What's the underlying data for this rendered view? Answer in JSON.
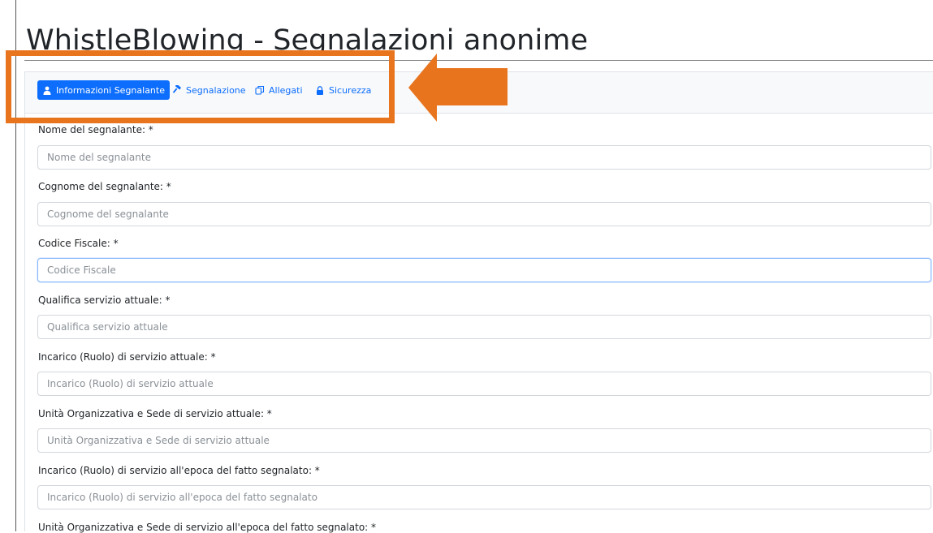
{
  "header": {
    "title": "WhistleBlowing - Segnalazioni anonime"
  },
  "tabs": [
    {
      "label": "Informazioni Segnalante",
      "icon": "user-icon",
      "active": true
    },
    {
      "label": "Segnalazione",
      "icon": "gavel-icon",
      "active": false
    },
    {
      "label": "Allegati",
      "icon": "copy-icon",
      "active": false
    },
    {
      "label": "Sicurezza",
      "icon": "lock-icon",
      "active": false
    }
  ],
  "form": {
    "fields": [
      {
        "label": "Nome del segnalante: *",
        "placeholder": "Nome del segnalante",
        "value": ""
      },
      {
        "label": "Cognome del segnalante: *",
        "placeholder": "Cognome del segnalante",
        "value": ""
      },
      {
        "label": "Codice Fiscale: *",
        "placeholder": "Codice Fiscale",
        "value": "",
        "focused": true
      },
      {
        "label": "Qualifica servizio attuale: *",
        "placeholder": "Qualifica servizio attuale",
        "value": ""
      },
      {
        "label": "Incarico (Ruolo) di servizio attuale: *",
        "placeholder": "Incarico (Ruolo) di servizio attuale",
        "value": ""
      },
      {
        "label": "Unità Organizzativa e Sede di servizio attuale: *",
        "placeholder": "Unità Organizzativa e Sede di servizio attuale",
        "value": ""
      },
      {
        "label": "Incarico (Ruolo) di servizio all'epoca del fatto segnalato: *",
        "placeholder": "Incarico (Ruolo) di servizio all'epoca del fatto segnalato",
        "value": ""
      },
      {
        "label": "Unità Organizzativa e Sede di servizio all'epoca del fatto segnalato: *"
      }
    ]
  },
  "annotation": {
    "box_color": "#e8741e",
    "arrow_color": "#e8741e"
  },
  "colors": {
    "accent": "#0d6efd"
  }
}
